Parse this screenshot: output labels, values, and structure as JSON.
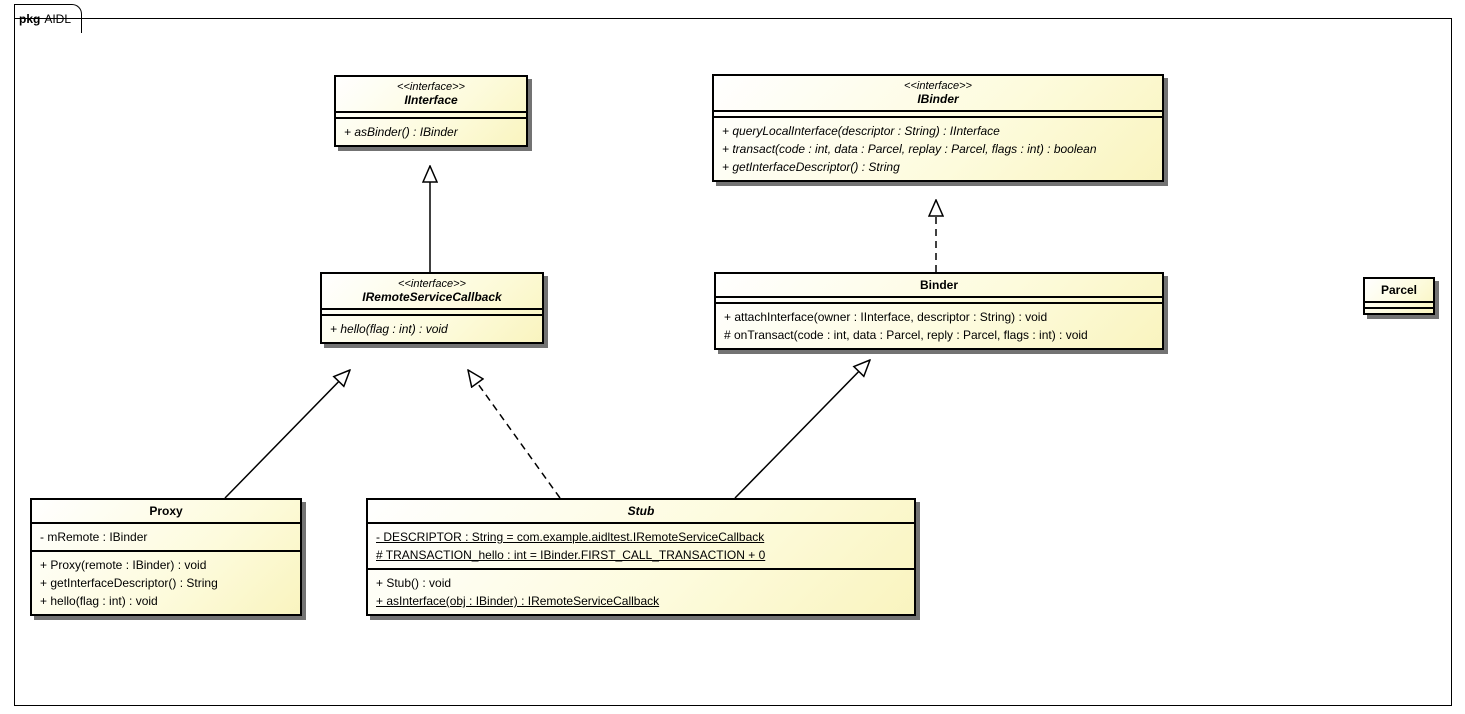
{
  "package": {
    "prefix": "pkg",
    "name": "AIDL"
  },
  "iinterface": {
    "stereo": "<<interface>>",
    "name": "IInterface",
    "methods": [
      "+ asBinder() : IBinder"
    ]
  },
  "iremote": {
    "stereo": "<<interface>>",
    "name": "IRemoteServiceCallback",
    "methods": [
      "+ hello(flag : int) : void"
    ]
  },
  "ibinder": {
    "stereo": "<<interface>>",
    "name": "IBinder",
    "methods": [
      "+ queryLocalInterface(descriptor : String) : IInterface",
      "+ transact(code : int, data : Parcel, replay : Parcel, flags : int) : boolean",
      "+ getInterfaceDescriptor() : String"
    ]
  },
  "binder": {
    "name": "Binder",
    "methods": [
      "+ attachInterface(owner : IInterface, descriptor : String) : void",
      "# onTransact(code : int, data : Parcel, reply : Parcel, flags : int) : void"
    ]
  },
  "parcel": {
    "name": "Parcel"
  },
  "proxy": {
    "name": "Proxy",
    "attrs": [
      "- mRemote : IBinder"
    ],
    "methods": [
      "+ Proxy(remote : IBinder) : void",
      "+ getInterfaceDescriptor() : String",
      "+ hello(flag : int) : void"
    ]
  },
  "stub": {
    "name": "Stub",
    "attrs": [
      "- DESCRIPTOR : String = com.example.aidltest.IRemoteServiceCallback",
      "# TRANSACTION_hello : int = IBinder.FIRST_CALL_TRANSACTION + 0"
    ],
    "methods": [
      "+ Stub() : void",
      "+ asInterface(obj : IBinder) : IRemoteServiceCallback"
    ]
  },
  "chart_data": {
    "type": "uml-class-diagram",
    "package": "AIDL",
    "classes": [
      {
        "name": "IInterface",
        "stereotype": "interface",
        "abstract": true,
        "operations": [
          {
            "vis": "+",
            "sig": "asBinder() : IBinder",
            "abstract": true
          }
        ]
      },
      {
        "name": "IRemoteServiceCallback",
        "stereotype": "interface",
        "abstract": true,
        "operations": [
          {
            "vis": "+",
            "sig": "hello(flag : int) : void",
            "abstract": true
          }
        ]
      },
      {
        "name": "IBinder",
        "stereotype": "interface",
        "abstract": true,
        "operations": [
          {
            "vis": "+",
            "sig": "queryLocalInterface(descriptor : String) : IInterface",
            "abstract": true
          },
          {
            "vis": "+",
            "sig": "transact(code : int, data : Parcel, replay : Parcel, flags : int) : boolean",
            "abstract": true
          },
          {
            "vis": "+",
            "sig": "getInterfaceDescriptor() : String",
            "abstract": true
          }
        ]
      },
      {
        "name": "Binder",
        "abstract": false,
        "operations": [
          {
            "vis": "+",
            "sig": "attachInterface(owner : IInterface, descriptor : String) : void"
          },
          {
            "vis": "#",
            "sig": "onTransact(code : int, data : Parcel, reply : Parcel, flags : int) : void"
          }
        ]
      },
      {
        "name": "Parcel"
      },
      {
        "name": "Proxy",
        "attributes": [
          {
            "vis": "-",
            "sig": "mRemote : IBinder"
          }
        ],
        "operations": [
          {
            "vis": "+",
            "sig": "Proxy(remote : IBinder) : void"
          },
          {
            "vis": "+",
            "sig": "getInterfaceDescriptor() : String"
          },
          {
            "vis": "+",
            "sig": "hello(flag : int) : void"
          }
        ]
      },
      {
        "name": "Stub",
        "abstract": true,
        "attributes": [
          {
            "vis": "-",
            "sig": "DESCRIPTOR : String = com.example.aidltest.IRemoteServiceCallback",
            "static": true
          },
          {
            "vis": "#",
            "sig": "TRANSACTION_hello : int = IBinder.FIRST_CALL_TRANSACTION + 0",
            "static": true
          }
        ],
        "operations": [
          {
            "vis": "+",
            "sig": "Stub() : void"
          },
          {
            "vis": "+",
            "sig": "asInterface(obj : IBinder) : IRemoteServiceCallback",
            "static": true
          }
        ]
      }
    ],
    "relationships": [
      {
        "from": "IRemoteServiceCallback",
        "to": "IInterface",
        "type": "generalization"
      },
      {
        "from": "Binder",
        "to": "IBinder",
        "type": "realization"
      },
      {
        "from": "Proxy",
        "to": "IRemoteServiceCallback",
        "type": "realization"
      },
      {
        "from": "Stub",
        "to": "IRemoteServiceCallback",
        "type": "realization"
      },
      {
        "from": "Stub",
        "to": "Binder",
        "type": "generalization"
      }
    ]
  }
}
